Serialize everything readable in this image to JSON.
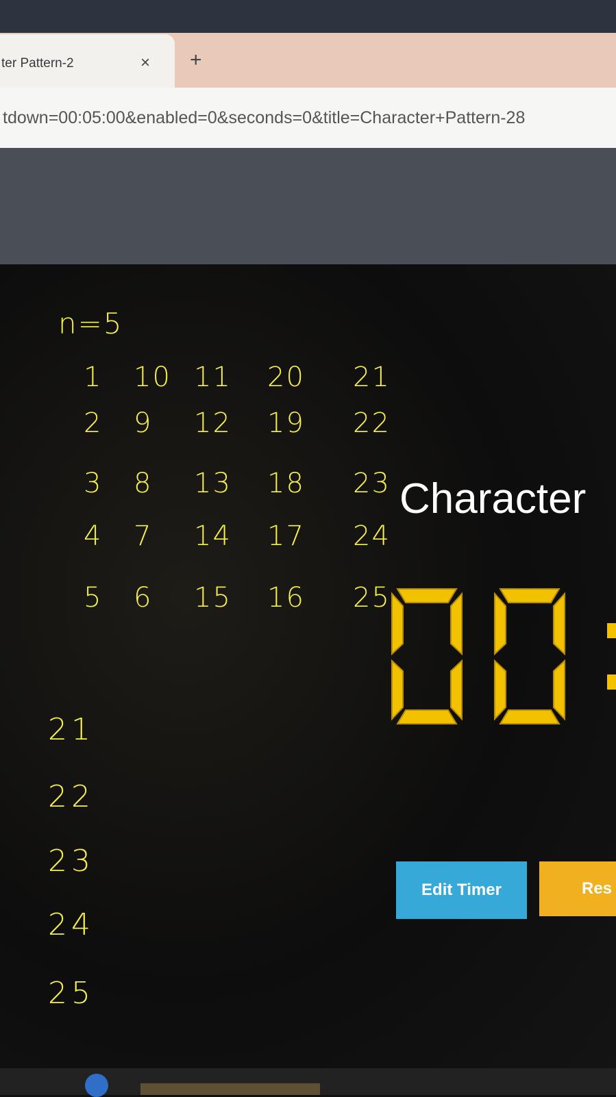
{
  "browser": {
    "tab_title": "ter Pattern-2",
    "tab_close": "×",
    "new_tab": "+",
    "url": "tdown=00:05:00&enabled=0&seconds=0&title=Character+Pattern-28"
  },
  "notes": {
    "n_label": "n=5",
    "grid": [
      [
        "1",
        "10",
        "11",
        "20",
        "21"
      ],
      [
        "2",
        "9",
        "12",
        "19",
        "22"
      ],
      [
        "3",
        "8",
        "13",
        "18",
        "23"
      ],
      [
        "4",
        "7",
        "14",
        "17",
        "24"
      ],
      [
        "5",
        "6",
        "15",
        "16",
        "25"
      ]
    ],
    "column": [
      "21",
      "22",
      "23",
      "24",
      "25"
    ]
  },
  "timer": {
    "title": "Character",
    "digits": "00"
  },
  "buttons": {
    "edit": "Edit Timer",
    "reset": "Res"
  },
  "colors": {
    "ink": "#f6f04a",
    "digit": "#f2c200",
    "edit_button": "#36a9d8",
    "reset_button": "#f0b020"
  }
}
